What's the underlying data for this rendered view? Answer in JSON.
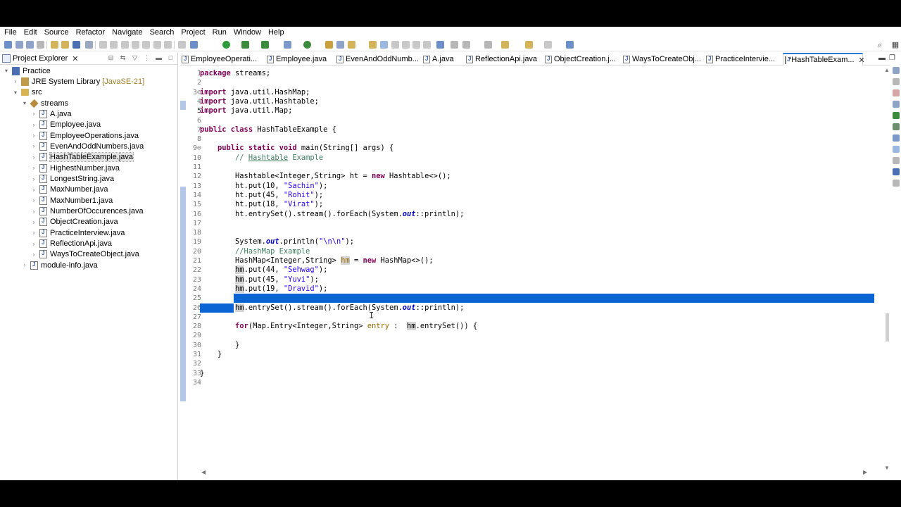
{
  "menu": [
    "File",
    "Edit",
    "Source",
    "Refactor",
    "Navigate",
    "Search",
    "Project",
    "Run",
    "Window",
    "Help"
  ],
  "explorer": {
    "title": "Project Explorer",
    "close": "✕",
    "tree": [
      {
        "label": "Practice",
        "decor": "",
        "twisty": "▾",
        "icon": "project"
      },
      {
        "label": "JRE System Library",
        "decor": "[JavaSE-21]",
        "twisty": "›",
        "icon": "library"
      },
      {
        "label": "src",
        "decor": "",
        "twisty": "▾",
        "icon": "folder"
      },
      {
        "label": "streams",
        "decor": "",
        "twisty": "▾",
        "icon": "package"
      },
      {
        "label": "A.java",
        "decor": "",
        "twisty": "›",
        "icon": "javafile"
      },
      {
        "label": "Employee.java",
        "decor": "",
        "twisty": "›",
        "icon": "javafile"
      },
      {
        "label": "EmployeeOperations.java",
        "decor": "",
        "twisty": "›",
        "icon": "javafile"
      },
      {
        "label": "EvenAndOddNumbers.java",
        "decor": "",
        "twisty": "›",
        "icon": "javafile"
      },
      {
        "label": "HashTableExample.java",
        "decor": "",
        "twisty": "›",
        "icon": "javafile",
        "selected": true
      },
      {
        "label": "HighestNumber.java",
        "decor": "",
        "twisty": "›",
        "icon": "javafile"
      },
      {
        "label": "LongestString.java",
        "decor": "",
        "twisty": "›",
        "icon": "javafile"
      },
      {
        "label": "MaxNumber.java",
        "decor": "",
        "twisty": "›",
        "icon": "javafile"
      },
      {
        "label": "MaxNumber1.java",
        "decor": "",
        "twisty": "›",
        "icon": "javafile"
      },
      {
        "label": "NumberOfOccurences.java",
        "decor": "",
        "twisty": "›",
        "icon": "javafile"
      },
      {
        "label": "ObjectCreation.java",
        "decor": "",
        "twisty": "›",
        "icon": "javafile"
      },
      {
        "label": "PracticeInterview.java",
        "decor": "",
        "twisty": "›",
        "icon": "javafile"
      },
      {
        "label": "ReflectionApi.java",
        "decor": "",
        "twisty": "›",
        "icon": "javafile"
      },
      {
        "label": "WaysToCreateObject.java",
        "decor": "",
        "twisty": "›",
        "icon": "javafile"
      },
      {
        "label": "module-info.java",
        "decor": "",
        "twisty": "›",
        "icon": "javafile"
      }
    ]
  },
  "editor": {
    "tabs": [
      {
        "label": "EmployeeOperati..."
      },
      {
        "label": "Employee.java"
      },
      {
        "label": "EvenAndOddNumb..."
      },
      {
        "label": "A.java"
      },
      {
        "label": "ReflectionApi.java"
      },
      {
        "label": "ObjectCreation.j..."
      },
      {
        "label": "WaysToCreateObj..."
      },
      {
        "label": "PracticeIntervie..."
      },
      {
        "label": "*HashTableExam...",
        "active": true
      }
    ],
    "lines": [
      {
        "n": "1",
        "html": "<span class='kw'>package</span> streams;"
      },
      {
        "n": "2",
        "html": ""
      },
      {
        "n": "3⊖",
        "html": "<span class='kw'>import</span> java.util.HashMap;"
      },
      {
        "n": "4",
        "html": "<span class='kw'>import</span> java.util.Hashtable;"
      },
      {
        "n": "5",
        "html": "<span class='kw'>import</span> java.util.Map;"
      },
      {
        "n": "6",
        "html": ""
      },
      {
        "n": "7",
        "html": "<span class='kw'>public class</span> HashTableExample {"
      },
      {
        "n": "8",
        "html": ""
      },
      {
        "n": "9⊖",
        "html": "    <span class='kw'>public static void</span> main(String[] args) {"
      },
      {
        "n": "10",
        "html": "        <span class='cm'>// <u>Hashtable</u> Example</span>"
      },
      {
        "n": "11",
        "html": ""
      },
      {
        "n": "12",
        "html": "        Hashtable&lt;Integer,String&gt; ht = <span class='kw'>new</span> Hashtable&lt;&gt;();"
      },
      {
        "n": "13",
        "html": "        ht.put(10, <span class='str'>\"Sachin\"</span>);"
      },
      {
        "n": "14",
        "html": "        ht.put(45, <span class='str'>\"Rohit\"</span>);"
      },
      {
        "n": "15",
        "html": "        ht.put(18, <span class='str'>\"Virat\"</span>);"
      },
      {
        "n": "16",
        "html": "        ht.entrySet().stream().forEach(System.<span class='fld'>out</span>::println);"
      },
      {
        "n": "17",
        "html": ""
      },
      {
        "n": "18",
        "html": ""
      },
      {
        "n": "19",
        "html": "        System.<span class='fld'>out</span>.println(<span class='str'>\"\\n\\n\"</span>);"
      },
      {
        "n": "20",
        "html": "        <span class='cm'>//HashMap Example</span>"
      },
      {
        "n": "21",
        "html": "        HashMap&lt;Integer,String&gt; <span class='occ warnvar'>hm</span> = <span class='kw'>new</span> HashMap&lt;&gt;();"
      },
      {
        "n": "22",
        "html": "        <span class='occ'>hm</span>.put(44, <span class='str'>\"Sehwag\"</span>);"
      },
      {
        "n": "23",
        "html": "        <span class='occ'>hm</span>.put(45, <span class='str'>\"Yuvi\"</span>);"
      },
      {
        "n": "24",
        "html": "        <span class='occ'>hm</span>.put(19, <span class='str'>\"Dravid\"</span>);"
      },
      {
        "n": "25",
        "html": ""
      },
      {
        "n": "26",
        "html": "        <span class='occ'>hm</span>.entrySet().stream().forEach(System.<span class='fld'>out</span>::println);"
      },
      {
        "n": "27",
        "html": ""
      },
      {
        "n": "28",
        "html": "        <span class='kw'>for</span>(Map.Entry&lt;Integer,String&gt; <span class='warnvar'>entry</span> :  <span class='occ'>hm</span>.entrySet()) {"
      },
      {
        "n": "29",
        "html": ""
      },
      {
        "n": "30",
        "html": "        }"
      },
      {
        "n": "31",
        "html": "    }"
      },
      {
        "n": "32",
        "html": ""
      },
      {
        "n": "33",
        "html": "}"
      },
      {
        "n": "34",
        "html": ""
      }
    ]
  },
  "colors": {
    "selection": "#0a64d4",
    "keyword": "#7f0055",
    "string": "#2a00ff",
    "comment": "#3f7f5f"
  }
}
